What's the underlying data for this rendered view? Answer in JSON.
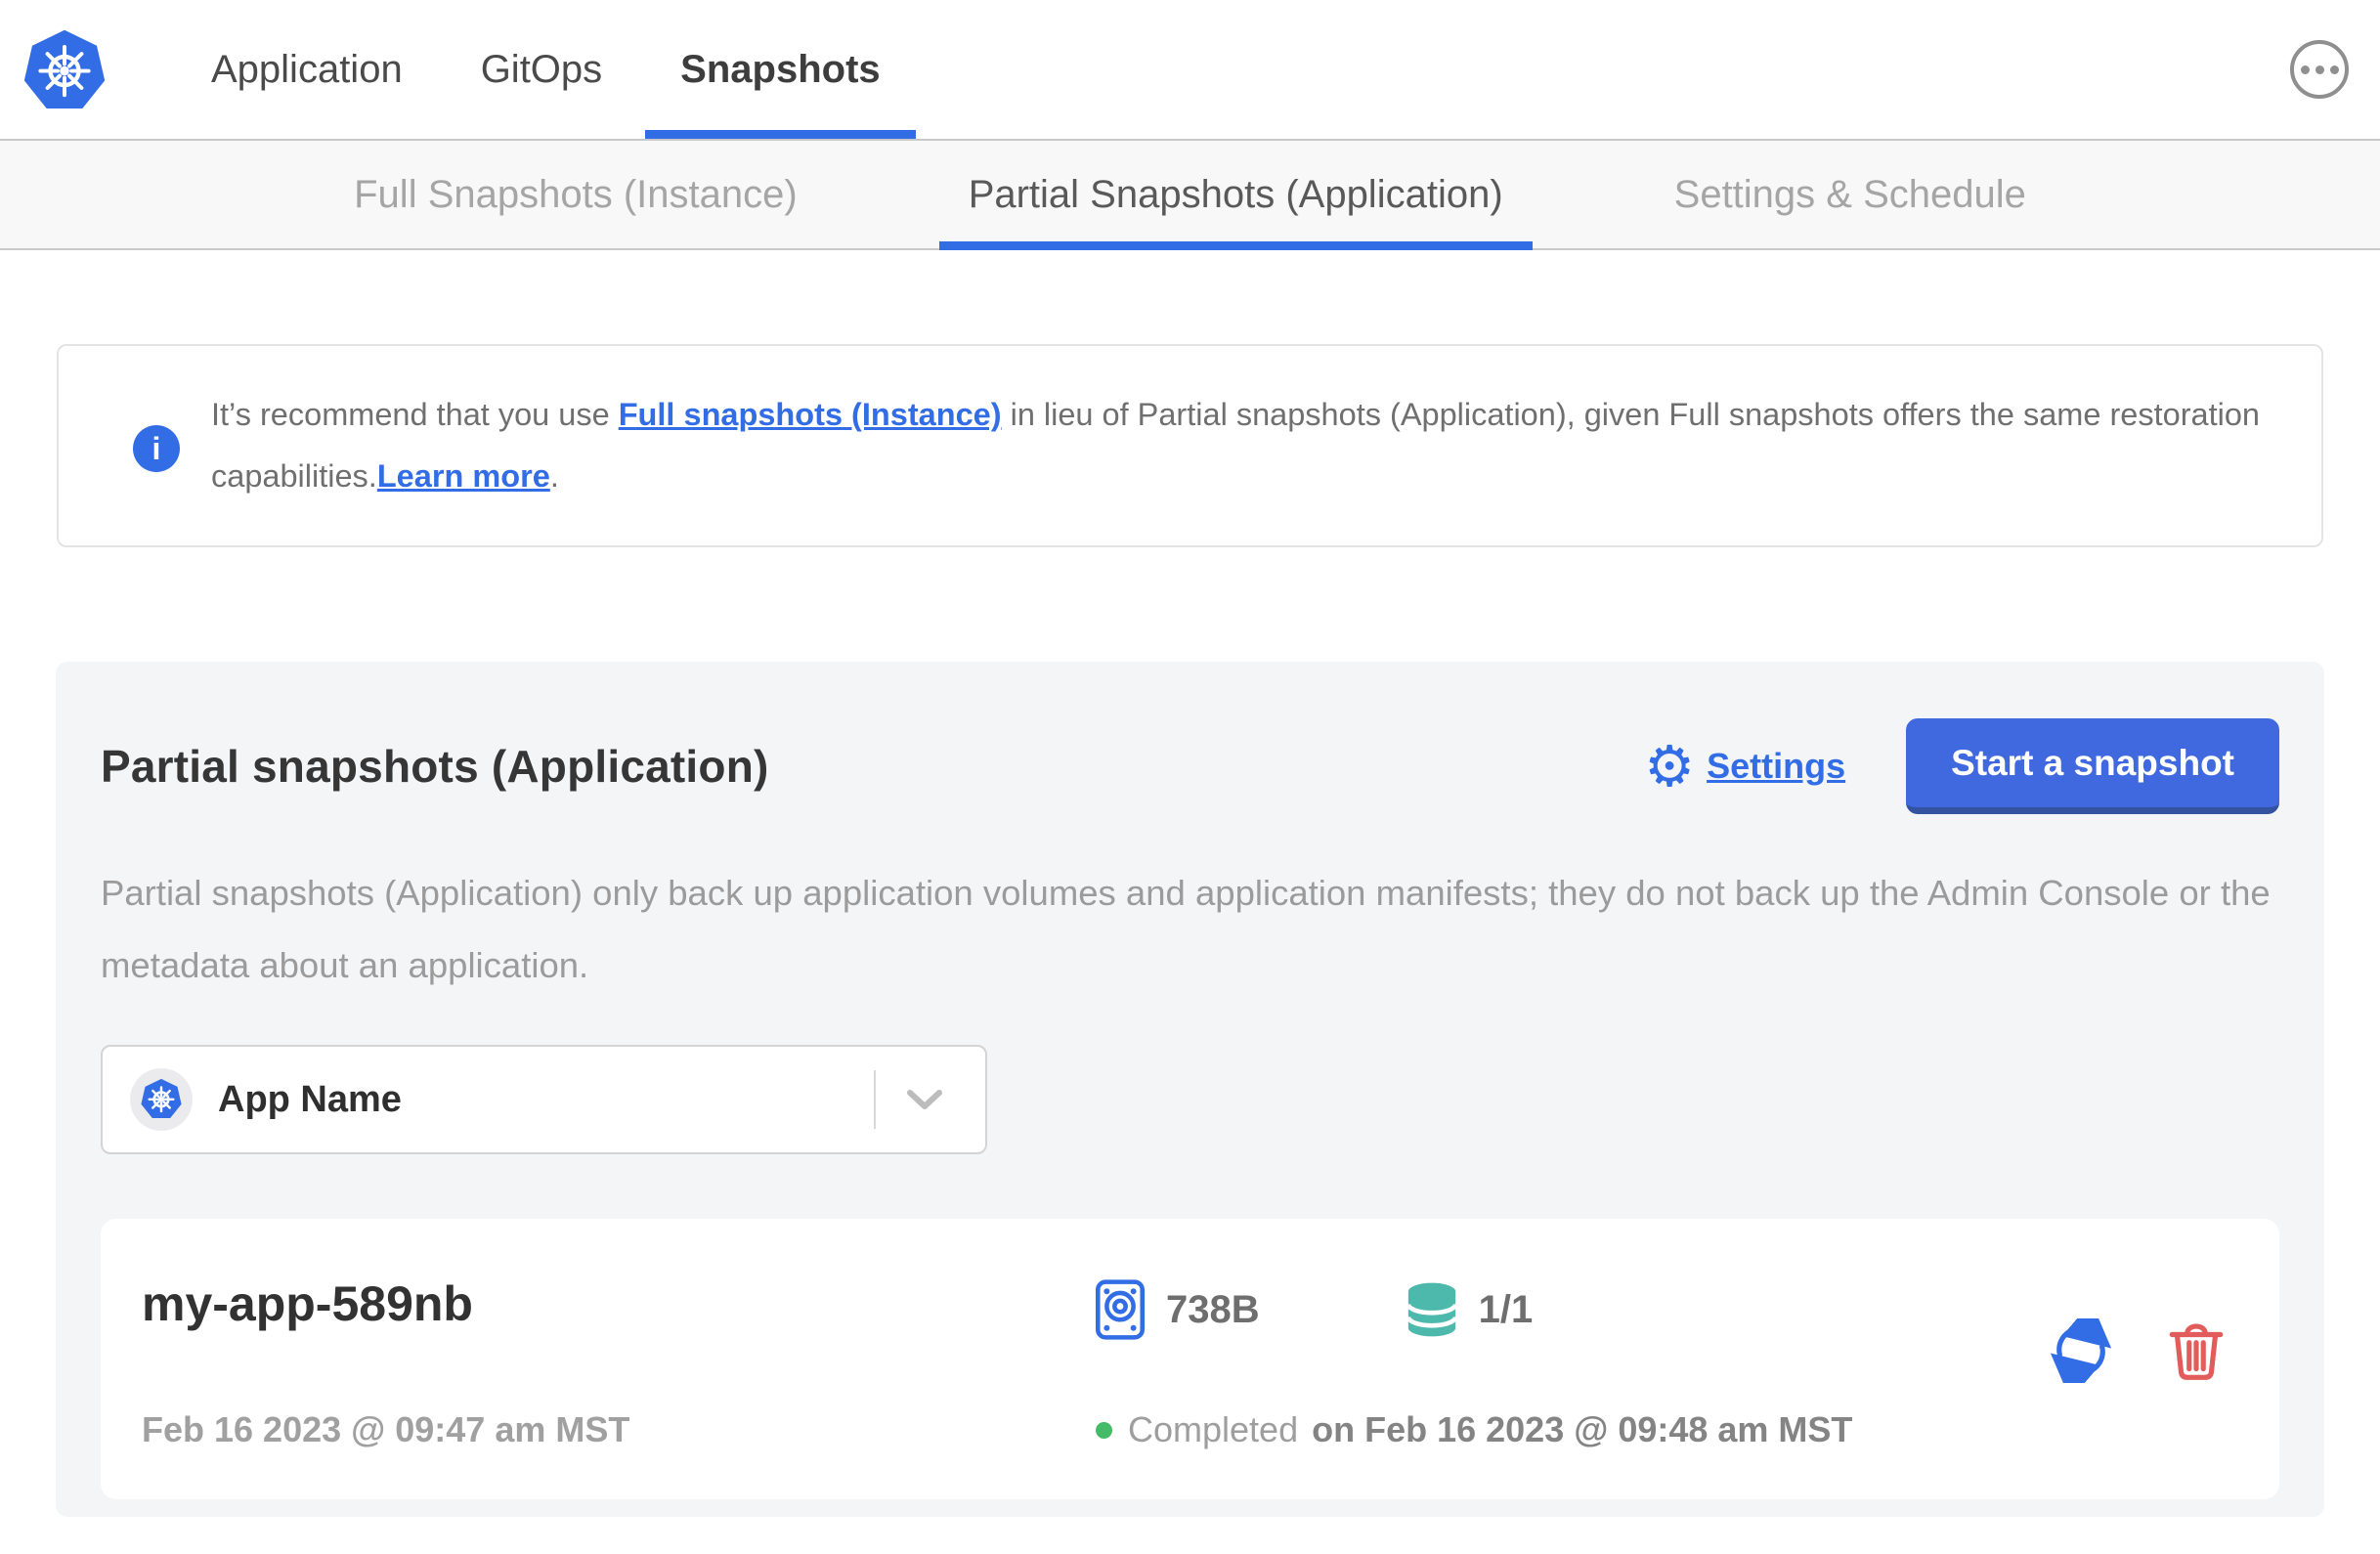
{
  "colors": {
    "accent_blue": "#326de6",
    "button_blue": "#4169df",
    "button_blue_shadow": "#33529f",
    "teal": "#4db9ac",
    "success_green": "#44bb66",
    "danger_red": "#e25c5c",
    "gray_text": "#9b9b9b"
  },
  "icons": {
    "logo": "kubernetes-logo",
    "menu": "ellipsis-icon",
    "info": "i",
    "gear": "⚙",
    "app_selector": "kubernetes-icon",
    "caret": "chevron-down-icon",
    "size": "disk-icon",
    "volumes": "database-icon",
    "restore": "restore-arrows-icon",
    "delete": "trash-icon"
  },
  "header": {
    "nav": [
      {
        "label": "Application",
        "active": false
      },
      {
        "label": "GitOps",
        "active": false
      },
      {
        "label": "Snapshots",
        "active": true
      }
    ]
  },
  "subnav": {
    "tabs": [
      {
        "label": "Full Snapshots (Instance)",
        "active": false
      },
      {
        "label": "Partial Snapshots (Application)",
        "active": true
      },
      {
        "label": "Settings & Schedule",
        "active": false
      }
    ]
  },
  "banner": {
    "text_before": "It’s recommend that you use ",
    "link_full_snapshots": "Full snapshots (Instance)",
    "text_middle": " in lieu of Partial snapshots (Application), given Full snapshots offers the same restoration capabilities.",
    "link_learn_more": "Learn more",
    "text_after": "."
  },
  "panel": {
    "title": "Partial snapshots (Application)",
    "settings_label": "Settings",
    "start_button_label": "Start a snapshot",
    "description": "Partial snapshots (Application) only back up application volumes and application manifests; they do not back up the Admin Console or the metadata about an application.",
    "app_selector": {
      "value": "App Name"
    },
    "snapshots": [
      {
        "name": "my-app-589nb",
        "started": "Feb 16 2023 @ 09:47 am MST",
        "size": "738B",
        "volumes": "1/1",
        "status": "Completed",
        "finished": "on Feb 16 2023 @ 09:48 am MST"
      }
    ]
  }
}
